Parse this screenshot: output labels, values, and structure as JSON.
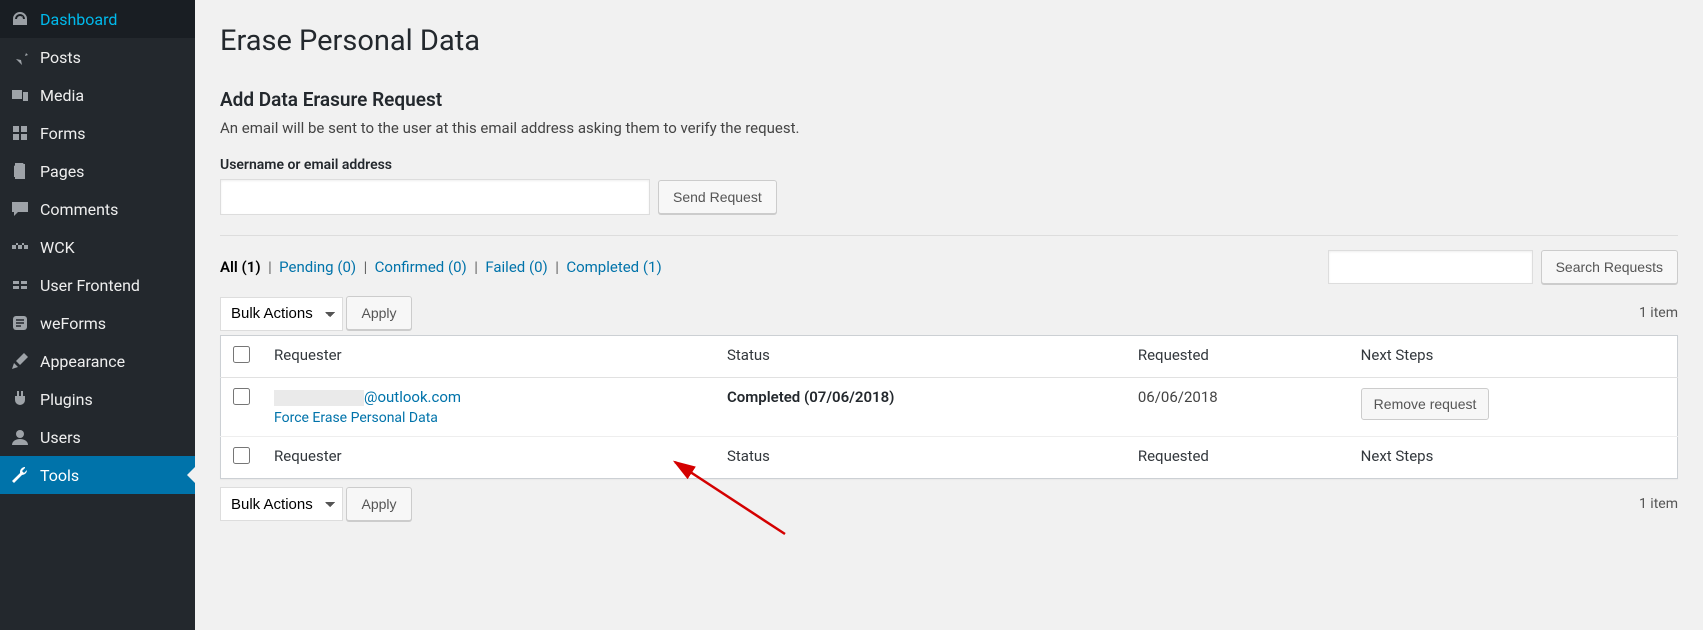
{
  "sidebar": {
    "items": [
      {
        "label": "Dashboard",
        "icon": "dashboard"
      },
      {
        "label": "Posts",
        "icon": "pin"
      },
      {
        "label": "Media",
        "icon": "media"
      },
      {
        "label": "Forms",
        "icon": "forms"
      },
      {
        "label": "Pages",
        "icon": "pages"
      },
      {
        "label": "Comments",
        "icon": "comment"
      },
      {
        "label": "WCK",
        "icon": "wck"
      },
      {
        "label": "User Frontend",
        "icon": "ufe"
      },
      {
        "label": "weForms",
        "icon": "weforms"
      },
      {
        "label": "Appearance",
        "icon": "brush"
      },
      {
        "label": "Plugins",
        "icon": "plug"
      },
      {
        "label": "Users",
        "icon": "user"
      },
      {
        "label": "Tools",
        "icon": "wrench"
      }
    ],
    "current_index": 12
  },
  "page": {
    "title": "Erase Personal Data",
    "subheading": "Add Data Erasure Request",
    "description": "An email will be sent to the user at this email address asking them to verify the request.",
    "input_label": "Username or email address",
    "send_button": "Send Request"
  },
  "filters": {
    "all": {
      "label": "All",
      "count": 1
    },
    "pending": {
      "label": "Pending",
      "count": 0
    },
    "confirmed": {
      "label": "Confirmed",
      "count": 0
    },
    "failed": {
      "label": "Failed",
      "count": 0
    },
    "completed": {
      "label": "Completed",
      "count": 1
    }
  },
  "search": {
    "button": "Search Requests"
  },
  "bulk": {
    "label": "Bulk Actions",
    "apply": "Apply"
  },
  "count_text": "1 item",
  "columns": {
    "requester": "Requester",
    "status": "Status",
    "requested": "Requested",
    "next": "Next Steps"
  },
  "rows": [
    {
      "email_suffix": "@outlook.com",
      "row_action": "Force Erase Personal Data",
      "status": "Completed (07/06/2018)",
      "requested": "06/06/2018",
      "next_button": "Remove request"
    }
  ]
}
